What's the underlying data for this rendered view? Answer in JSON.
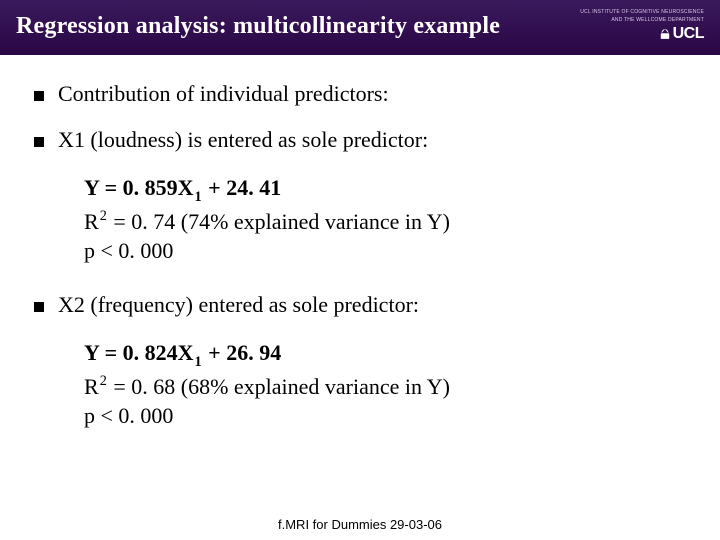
{
  "header": {
    "title": "Regression analysis: multicollinearity example",
    "institute_line1": "UCL INSTITUTE OF COGNITIVE NEUROSCIENCE",
    "institute_line2": "AND THE WELLCOME DEPARTMENT",
    "logo_text": "UCL"
  },
  "body": {
    "intro": "Contribution of individual predictors:",
    "block1": {
      "heading": "X1 (loudness) is entered as sole predictor:",
      "eq_pre": "Y = 0. 859X",
      "eq_sub": "1",
      "eq_post": " + 24. 41",
      "r2_pre": "R",
      "r2_sup": "2",
      "r2_post": " = 0. 74 (74% explained variance in Y)",
      "p": "p < 0. 000"
    },
    "block2": {
      "heading": "X2 (frequency) entered as sole predictor:",
      "eq_pre": "Y = 0. 824X",
      "eq_sub": "1",
      "eq_post": " + 26. 94",
      "r2_pre": "R",
      "r2_sup": "2",
      "r2_post": " = 0. 68 (68% explained variance in Y)",
      "p": "p < 0. 000"
    }
  },
  "footer": {
    "text": "f.MRI for Dummies 29-03-06"
  }
}
